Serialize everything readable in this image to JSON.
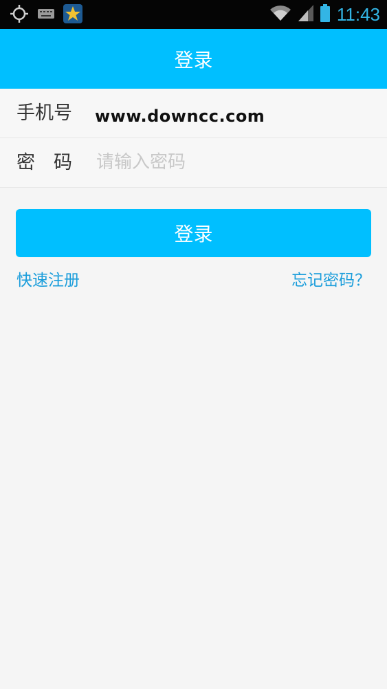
{
  "status_bar": {
    "time": "11:43",
    "icons": [
      "gps-icon",
      "keyboard-icon",
      "star-app-icon",
      "wifi-icon",
      "signal-icon",
      "battery-icon"
    ]
  },
  "header": {
    "title": "登录"
  },
  "form": {
    "phone_label": "手机号",
    "phone_value": "www.downcc.com",
    "password_label": "密　码",
    "password_placeholder": "请输入密码"
  },
  "actions": {
    "login_label": "登录",
    "register_label": "快速注册",
    "forgot_label": "忘记密码？"
  },
  "colors": {
    "accent": "#00bfff",
    "link": "#1a9ddb",
    "status_bar_text": "#33b5e5",
    "background": "#f5f5f5"
  }
}
